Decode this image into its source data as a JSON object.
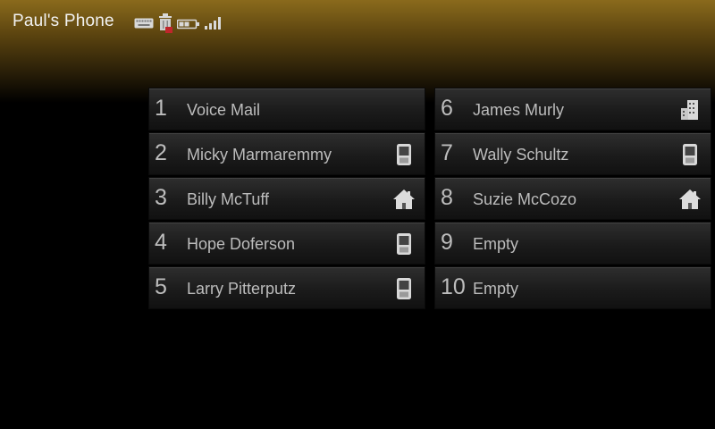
{
  "header": {
    "title": "Paul's Phone",
    "status_icons": [
      "keyboard-icon",
      "trash-icon",
      "battery-icon",
      "signal-icon"
    ]
  },
  "speed_dial": {
    "slots": [
      {
        "number": "1",
        "name": "Voice Mail",
        "icon": "none"
      },
      {
        "number": "6",
        "name": "James Murly",
        "icon": "office-building-icon"
      },
      {
        "number": "2",
        "name": "Micky Marmaremmy",
        "icon": "mobile-phone-icon"
      },
      {
        "number": "7",
        "name": "Wally Schultz",
        "icon": "mobile-phone-icon"
      },
      {
        "number": "3",
        "name": "Billy McTuff",
        "icon": "home-icon"
      },
      {
        "number": "8",
        "name": "Suzie McCozo",
        "icon": "home-icon"
      },
      {
        "number": "4",
        "name": "Hope Doferson",
        "icon": "mobile-phone-icon"
      },
      {
        "number": "9",
        "name": "Empty",
        "icon": "none"
      },
      {
        "number": "5",
        "name": "Larry Pitterputz",
        "icon": "mobile-phone-icon"
      },
      {
        "number": "10",
        "name": "Empty",
        "icon": "none"
      }
    ]
  },
  "colors": {
    "header_gradient_top": "#8a6a1c",
    "background": "#000000",
    "slot_text": "#bcbcbc",
    "icon_fill": "#d8d8d8"
  }
}
